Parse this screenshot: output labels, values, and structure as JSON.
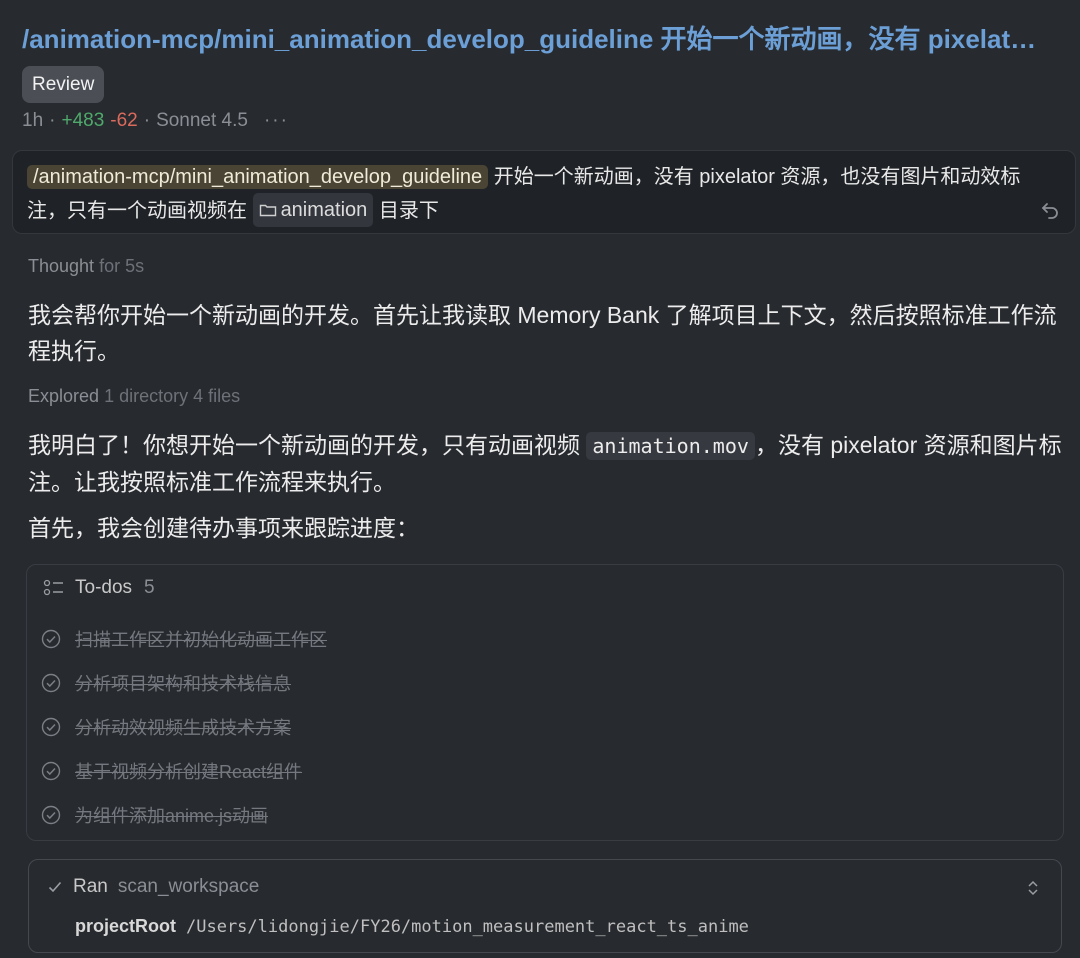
{
  "header": {
    "title": "/animation-mcp/mini_animation_develop_guideline 开始一个新动画，没有 pixelat…",
    "badge": "Review",
    "time": "1h",
    "additions": "+483",
    "deletions": "-62",
    "model": "Sonnet 4.5",
    "more": "···"
  },
  "prompt": {
    "command": "/animation-mcp/mini_animation_develop_guideline",
    "text_part1": " 开始一个新动画，没有 pixelator 资源，也没有图片和动效标注，只有一个动画视频在 ",
    "folder": "animation",
    "text_part2": " 目录下"
  },
  "thought": {
    "label": "Thought",
    "duration": "for 5s"
  },
  "messages": {
    "p1": "我会帮你开始一个新动画的开发。首先让我读取 Memory Bank 了解项目上下文，然后按照标准工作流程执行。",
    "explored_label": "Explored",
    "explored_detail": "1 directory 4 files",
    "p2_before": "我明白了！你想开始一个新动画的开发，只有动画视频 ",
    "p2_code": "animation.mov",
    "p2_after": "，没有 pixelator 资源和图片标注。让我按照标准工作流程来执行。",
    "p3": "首先，我会创建待办事项来跟踪进度："
  },
  "todos": {
    "label": "To-dos",
    "count": "5",
    "items": [
      "扫描工作区并初始化动画工作区",
      "分析项目架构和技术栈信息",
      "分析动效视频生成技术方案",
      "基于视频分析创建React组件",
      "为组件添加anime.js动画"
    ]
  },
  "ran": {
    "label": "Ran",
    "tool": "scan_workspace",
    "param_key": "projectRoot",
    "param_value": "/Users/lidongjie/FY26/motion_measurement_react_ts_anime"
  }
}
